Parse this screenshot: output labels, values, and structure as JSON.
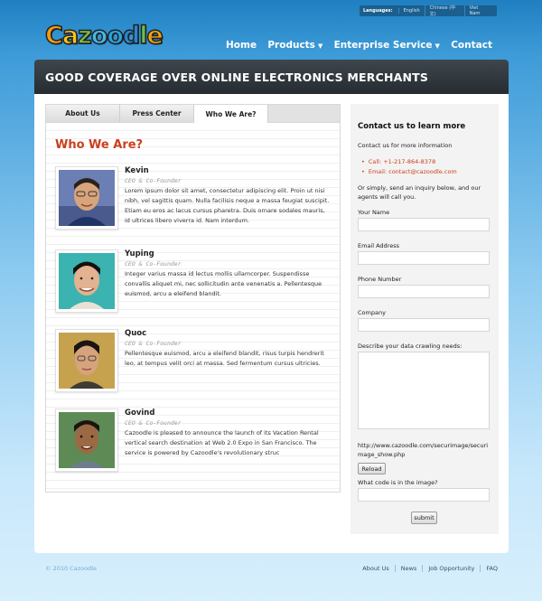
{
  "languages": {
    "label": "Languages:",
    "items": [
      "English",
      "Chinese (中文)",
      "Viet Nam"
    ]
  },
  "logo": {
    "text": "Cazoodle",
    "letter_colors": [
      "#f39c12",
      "#f7c21a",
      "#7ac143",
      "#46b7e6",
      "#2aa2df",
      "#2a86d0",
      "#6bc04b",
      "#f2a30f"
    ]
  },
  "nav": {
    "home": "Home",
    "products": "Products",
    "enterprise": "Enterprise Service",
    "contact": "Contact"
  },
  "banner": {
    "title": "GOOD COVERAGE OVER ONLINE ELECTRONICS MERCHANTS"
  },
  "tabs": [
    "About Us",
    "Press Center",
    "Who We Are?"
  ],
  "section_title": "Who We Are?",
  "people": [
    {
      "name": "Kevin",
      "role": "CEO & Co-Founder",
      "bio": "Lorem ipsum dolor sit amet, consectetur adipiscing elit. Proin ut nisi nibh, vel sagittis quam. Nulla facilisis neque a massa feugiat suscipit. Etiam eu eros ac lacus cursus pharetra. Duis ornare sodales mauris, id ultrices libero viverra id. Nam interdum."
    },
    {
      "name": "Yuping",
      "role": "CEO & Co-Founder",
      "bio": "Integer varius massa id lectus mollis ullamcorper. Suspendisse convallis aliquet mi, nec sollicitudin ante venenatis a. Pellentesque euismod, arcu a eleifend blandit."
    },
    {
      "name": "Quoc",
      "role": "CEO & Co-Founder",
      "bio": "Pellentesque euismod, arcu a eleifend blandit, risus turpis hendrerit leo, at tempus velit orci at massa. Sed fermentum cursus ultricies."
    },
    {
      "name": "Govind",
      "role": "CEO & Co-Founder",
      "bio": "Cazoodle is pleased to announce the launch of its Vacation Rental vertical search destination at Web 2.0 Expo in San Francisco. The service is powered by Cazoodle's revolutionary struc"
    }
  ],
  "contact_form": {
    "title": "Contact us to learn more",
    "intro": "Contact us for more information",
    "call": "Call: +1-217-864-8378",
    "email": "Email: contact@cazoodle.com",
    "alt_text": "Or simply, send an inquiry below, and our agents will call you.",
    "labels": {
      "name": "Your Name",
      "email": "Email Address",
      "phone": "Phone Number",
      "company": "Company",
      "needs": "Describe your data crawling needs:",
      "captcha_q": "What code is in the image?"
    },
    "captcha_url": "http://www.cazoodle.com/securimage/securimage_show.php",
    "reload": "Reload",
    "submit": "submit"
  },
  "footer": {
    "copyright": "© 2010 Cazoodle",
    "links": [
      "About Us",
      "News",
      "Job Opportunity",
      "FAQ"
    ]
  }
}
